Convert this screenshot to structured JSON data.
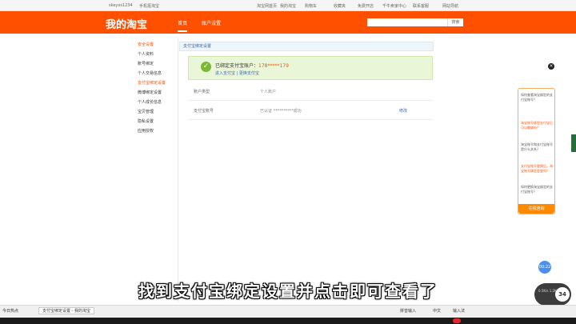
{
  "topbar": {
    "username": "skeyxs1234",
    "message_link": "手机逛淘宝",
    "links": [
      "淘宝网首页",
      "我的淘宝",
      "购物车",
      "收藏夹",
      "免费开店",
      "千牛卖家中心",
      "联系客服",
      "网站导航"
    ]
  },
  "header": {
    "logo": "我的淘宝",
    "nav": [
      "首页",
      "账户设置"
    ],
    "search_placeholder": "",
    "search_button": "搜索"
  },
  "sidebar": {
    "items": [
      "安全设置",
      "个人资料",
      "账号绑定",
      "个人交易信息",
      "支付宝绑定设置",
      "微博绑定设置",
      "个人成长信息",
      "宝贝管理",
      "隐私设置",
      "应用授权"
    ]
  },
  "main": {
    "panel_title": "支付宝绑定设置",
    "notice": {
      "text": "已绑定支付宝账户：",
      "phone": "178*****179",
      "links": "进入支付宝 | 更换支付宝"
    },
    "rows": [
      {
        "label": "账户类型",
        "value": "个人账户",
        "action": ""
      },
      {
        "label": "支付宝账号",
        "value": "已认证 **********成功",
        "action": "修改"
      }
    ]
  },
  "side_panel": {
    "items": [
      "如何查看淘宝绑定的支付宝账号？",
      "淘宝账号绑定支付宝后可以解绑吗？",
      "淘宝账号和支付宝账号是什么关系？",
      "支付宝账号更换后，淘宝账号绑定会变吗？",
      "如何更换淘宝绑定的支付宝账号？"
    ],
    "button": "在线咨询"
  },
  "overlay": {
    "subtitle": "找到支付宝绑定设置并点击即可查看了",
    "blue_dot": "00:22",
    "widget_label": "0.5K/s\n1.2K/s",
    "widget_num": "34"
  },
  "taskbar": {
    "main": "今日热点",
    "window": "支付宝绑定设置 - 我的淘宝",
    "right1": "拼音输入",
    "right2": "中文",
    "right3": "输入法"
  }
}
